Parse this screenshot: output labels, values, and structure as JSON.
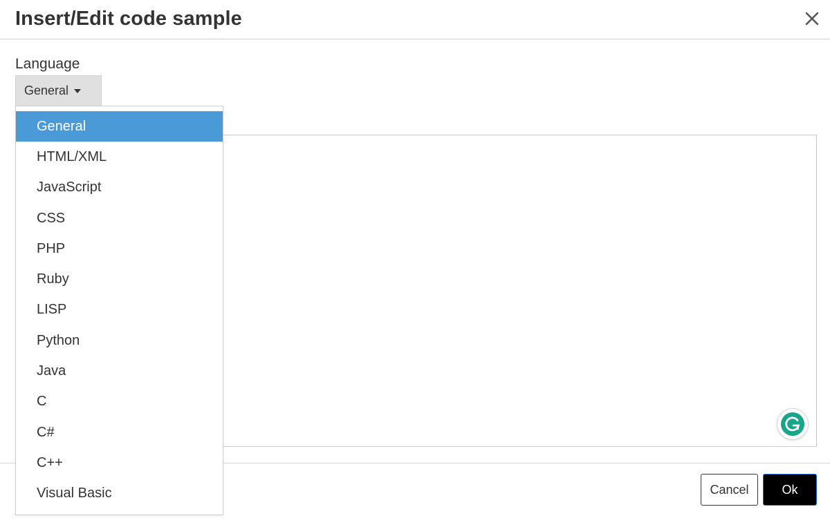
{
  "dialog": {
    "title": "Insert/Edit code sample",
    "close_icon": "close-icon"
  },
  "language": {
    "label": "Language",
    "selected": "General",
    "options": [
      "General",
      "HTML/XML",
      "JavaScript",
      "CSS",
      "PHP",
      "Ruby",
      "LISP",
      "Python",
      "Java",
      "C",
      "C#",
      "C++",
      "Visual Basic"
    ],
    "highlighted_index": 0
  },
  "code": {
    "value": ""
  },
  "grammarly": {
    "icon": "grammarly-icon",
    "color": "#15c39a"
  },
  "footer": {
    "cancel_label": "Cancel",
    "ok_label": "Ok"
  },
  "colors": {
    "highlight": "#4a9ad8",
    "primary_button": "#000000"
  }
}
